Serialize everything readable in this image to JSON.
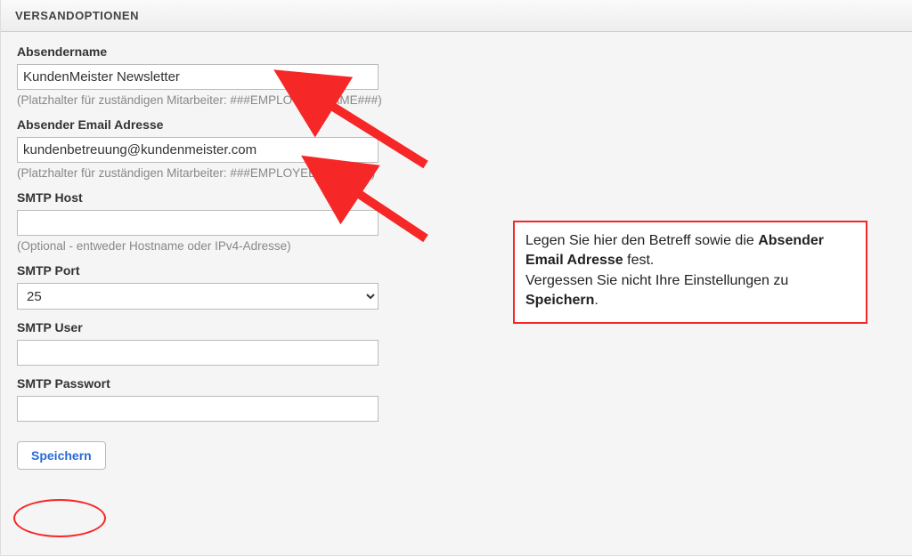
{
  "panel": {
    "title": "VERSANDOPTIONEN"
  },
  "fields": {
    "sender_name": {
      "label": "Absendername",
      "value": "KundenMeister Newsletter",
      "hint": "(Platzhalter für zuständigen Mitarbeiter: ###EMPLOYEE_NAME###)"
    },
    "sender_email": {
      "label": "Absender Email Adresse",
      "value": "kundenbetreuung@kundenmeister.com",
      "hint": "(Platzhalter für zuständigen Mitarbeiter: ###EMPLOYEE_MAIL###)"
    },
    "smtp_host": {
      "label": "SMTP Host",
      "value": "",
      "hint": "(Optional - entweder Hostname oder IPv4-Adresse)"
    },
    "smtp_port": {
      "label": "SMTP Port",
      "value": "25"
    },
    "smtp_user": {
      "label": "SMTP User",
      "value": ""
    },
    "smtp_password": {
      "label": "SMTP Passwort",
      "value": ""
    }
  },
  "actions": {
    "save_label": "Speichern"
  },
  "callout": {
    "line1_a": "Legen Sie hier den Betreff sowie die ",
    "line1_b": "Absender Email Adresse",
    "line1_c": " fest.",
    "line2_a": "Vergessen Sie nicht Ihre Einstellungen zu ",
    "line2_b": "Speichern",
    "line2_c": "."
  }
}
